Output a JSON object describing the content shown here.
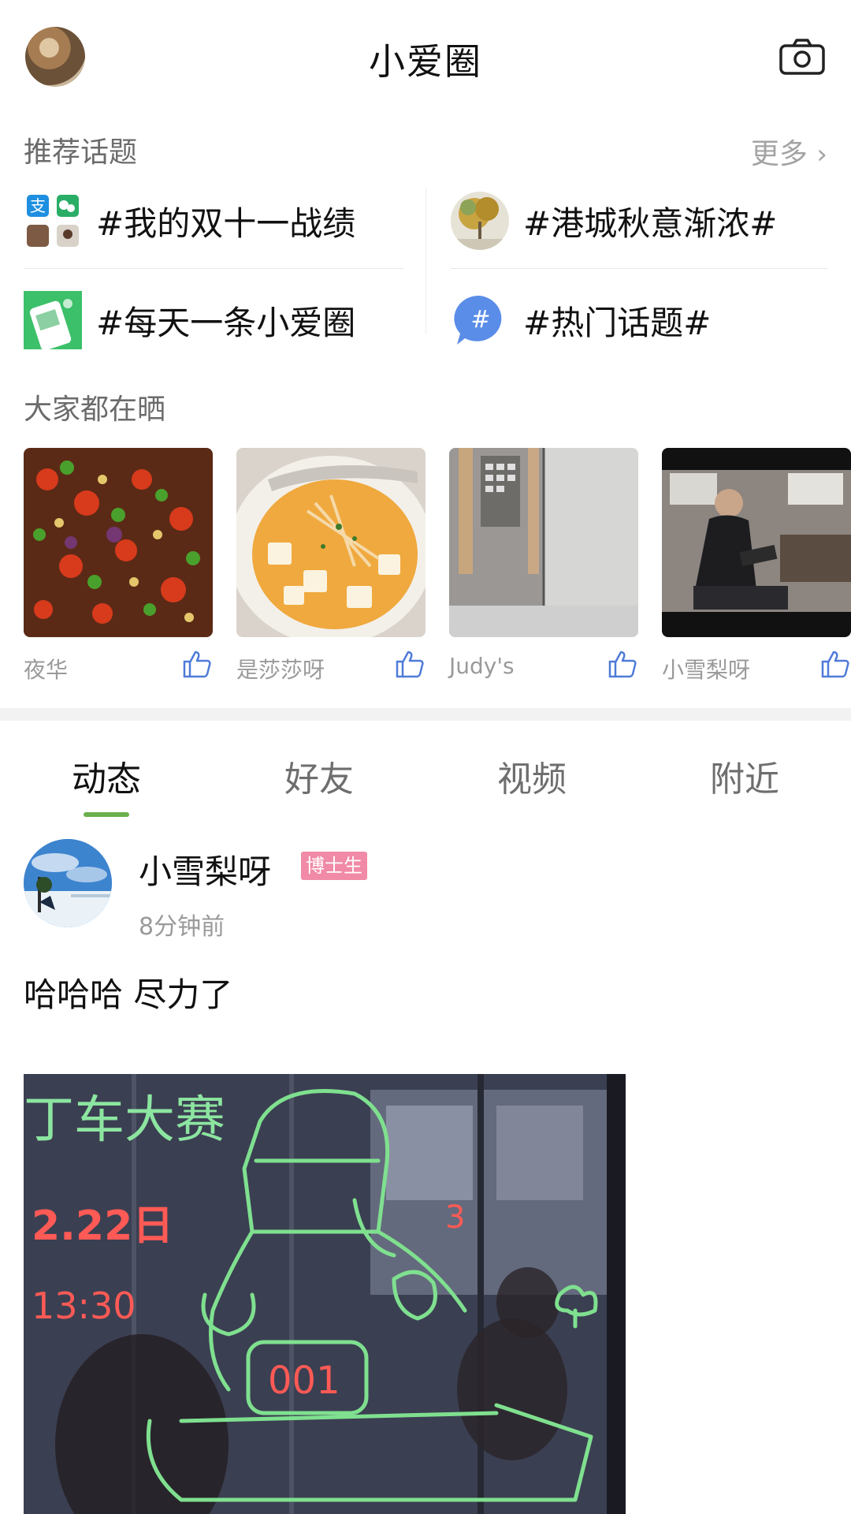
{
  "header": {
    "title": "小爱圈"
  },
  "topics": {
    "label": "推荐话题",
    "more": "更多",
    "items": [
      {
        "text": "#我的双十一战绩",
        "icon": "app-grid-icon"
      },
      {
        "text": "#港城秋意渐浓#",
        "icon": "autumn-tree-thumb"
      },
      {
        "text": "#每天一条小爱圈",
        "icon": "phone-app-thumb"
      },
      {
        "text": "#热门话题#",
        "icon": "hashtag-bubble-icon"
      }
    ]
  },
  "share": {
    "label": "大家都在晒",
    "items": [
      {
        "user": "夜华",
        "image": "spicy-chicken-dish"
      },
      {
        "user": "是莎莎呀",
        "image": "tofu-soup-dish"
      },
      {
        "user": "Judy's",
        "image": "glass-door-selfie"
      },
      {
        "user": "小雪梨呀",
        "image": "man-reading-video"
      }
    ]
  },
  "tabs": [
    {
      "label": "动态",
      "active": true
    },
    {
      "label": "好友",
      "active": false
    },
    {
      "label": "视频",
      "active": false
    },
    {
      "label": "附近",
      "active": false
    }
  ],
  "post": {
    "user": "小雪梨呀",
    "badge": "博士生",
    "time": "8分钟前",
    "text": "哈哈哈 尽力了",
    "image_text": {
      "line1": "丁车大赛",
      "date": "2.22日",
      "time": "13:30",
      "number": "001",
      "mark": "3"
    }
  },
  "colors": {
    "accent_green": "#6ab04c",
    "badge_pink": "#f08aa6",
    "label_gray": "#6b6b6b",
    "muted_gray": "#9a9a9a"
  }
}
